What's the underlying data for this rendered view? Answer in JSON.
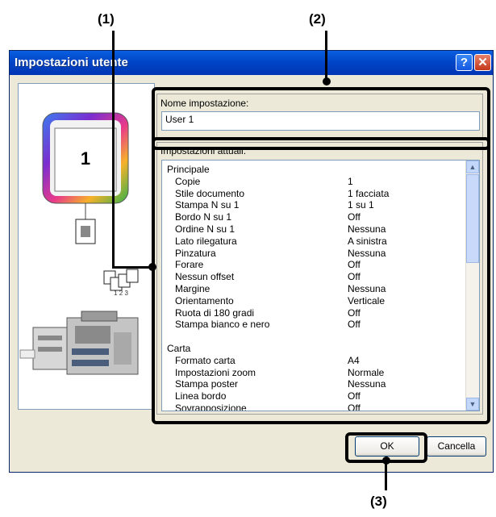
{
  "callouts": {
    "c1": "(1)",
    "c2": "(2)",
    "c3": "(3)"
  },
  "dialog": {
    "title": "Impostazioni utente",
    "help_label": "?",
    "close_label": "✕"
  },
  "preview": {
    "page_number": "1",
    "staple_label": "1 2 3"
  },
  "name_group": {
    "label": "Nome impostazione:",
    "value": "User 1"
  },
  "settings_group": {
    "label": "Impostazioni attuali:",
    "rows": [
      {
        "k": "Principale",
        "v": "",
        "indent": false
      },
      {
        "k": "Copie",
        "v": "1",
        "indent": true
      },
      {
        "k": "Stile documento",
        "v": "1 facciata",
        "indent": true
      },
      {
        "k": "Stampa N su 1",
        "v": "1 su 1",
        "indent": true
      },
      {
        "k": "Bordo N su 1",
        "v": "Off",
        "indent": true
      },
      {
        "k": "Ordine N su 1",
        "v": "Nessuna",
        "indent": true
      },
      {
        "k": "Lato rilegatura",
        "v": "A sinistra",
        "indent": true
      },
      {
        "k": "Pinzatura",
        "v": "Nessuna",
        "indent": true
      },
      {
        "k": "Forare",
        "v": "Off",
        "indent": true
      },
      {
        "k": "Nessun offset",
        "v": "Off",
        "indent": true
      },
      {
        "k": "Margine",
        "v": "Nessuna",
        "indent": true
      },
      {
        "k": "Orientamento",
        "v": "Verticale",
        "indent": true
      },
      {
        "k": "Ruota di 180 gradi",
        "v": "Off",
        "indent": true
      },
      {
        "k": "Stampa bianco e nero",
        "v": "Off",
        "indent": true
      },
      {
        "k": "",
        "v": "",
        "indent": false
      },
      {
        "k": "Carta",
        "v": "",
        "indent": false
      },
      {
        "k": "Formato carta",
        "v": "A4",
        "indent": true
      },
      {
        "k": "Impostazioni zoom",
        "v": "Normale",
        "indent": true
      },
      {
        "k": "Stampa poster",
        "v": "Nessuna",
        "indent": true
      },
      {
        "k": "Linea bordo",
        "v": "Off",
        "indent": true
      },
      {
        "k": "Sovrapposizione",
        "v": "Off",
        "indent": true
      }
    ]
  },
  "buttons": {
    "ok": "OK",
    "cancel": "Cancella"
  }
}
